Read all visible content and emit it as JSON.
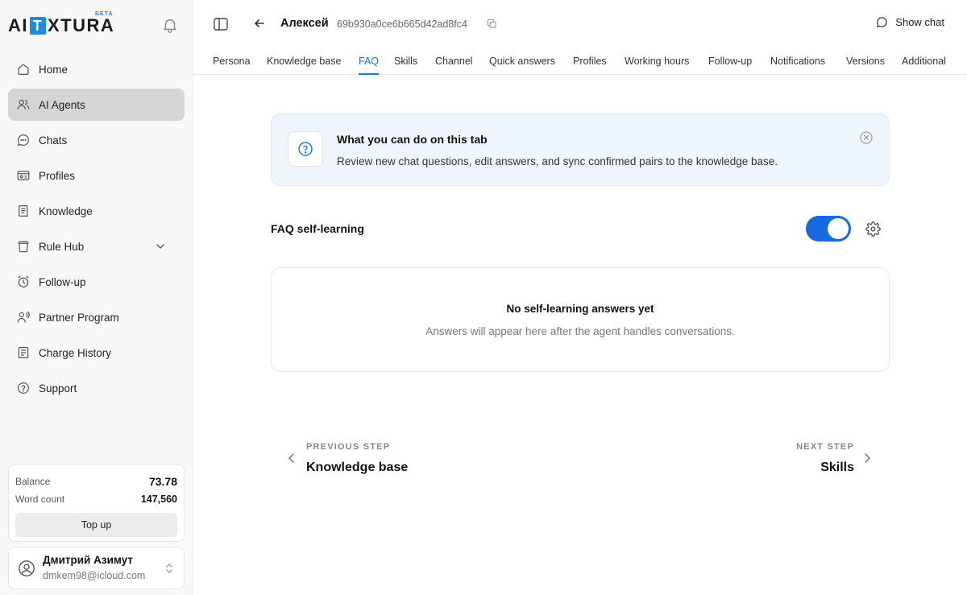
{
  "brand": {
    "logo_left": "AI",
    "logo_t": "T",
    "logo_right": "XTURA",
    "badge": "BETA"
  },
  "sidebar": {
    "items": [
      {
        "label": "Home",
        "icon": "home-icon",
        "active": false
      },
      {
        "label": "AI Agents",
        "icon": "users-icon",
        "active": true
      },
      {
        "label": "Chats",
        "icon": "chat-bubble-icon",
        "active": false
      },
      {
        "label": "Profiles",
        "icon": "id-card-icon",
        "active": false
      },
      {
        "label": "Knowledge",
        "icon": "book-icon",
        "active": false
      },
      {
        "label": "Rule Hub",
        "icon": "rule-hub-icon",
        "active": false,
        "expandable": true
      },
      {
        "label": "Follow-up",
        "icon": "alarm-clock-icon",
        "active": false
      },
      {
        "label": "Partner Program",
        "icon": "partner-icon",
        "active": false
      },
      {
        "label": "Charge History",
        "icon": "receipt-icon",
        "active": false
      },
      {
        "label": "Support",
        "icon": "help-circle-icon",
        "active": false
      }
    ],
    "balance": {
      "balance_label": "Balance",
      "balance_value": "73.78",
      "words_label": "Word count",
      "words_value": "147,560",
      "topup_label": "Top up"
    },
    "user": {
      "name": "Дмитрий Азимут",
      "email": "dmkem98@icloud.com"
    }
  },
  "header": {
    "agent_name": "Алексей",
    "agent_id": "69b930a0ce6b665d42ad8fc4",
    "show_chat_label": "Show chat"
  },
  "tabs": [
    {
      "label": "Persona",
      "active": false
    },
    {
      "label": "Knowledge base",
      "active": false
    },
    {
      "label": "FAQ",
      "active": true
    },
    {
      "label": "Skills",
      "active": false
    },
    {
      "label": "Channel",
      "active": false
    },
    {
      "label": "Quick answers",
      "active": false
    },
    {
      "label": "Profiles",
      "active": false
    },
    {
      "label": "Working hours",
      "active": false
    },
    {
      "label": "Follow-up",
      "active": false
    },
    {
      "label": "Notifications",
      "active": false
    },
    {
      "label": "Versions",
      "active": false
    },
    {
      "label": "Additional",
      "active": false
    }
  ],
  "info": {
    "title": "What you can do on this tab",
    "description": "Review new chat questions, edit answers, and sync confirmed pairs to the knowledge base."
  },
  "faq": {
    "self_learning_label": "FAQ self-learning",
    "enabled": true,
    "empty_title": "No self-learning answers yet",
    "empty_description": "Answers will appear here after the agent handles conversations."
  },
  "steps": {
    "prev_caption": "PREVIOUS STEP",
    "prev_title": "Knowledge base",
    "next_caption": "NEXT STEP",
    "next_title": "Skills"
  },
  "colors": {
    "accent": "#1a73e8",
    "toggle": "#1769e0",
    "banner_bg": "#f0f6fd",
    "active_nav_bg": "#d5d5d7"
  }
}
